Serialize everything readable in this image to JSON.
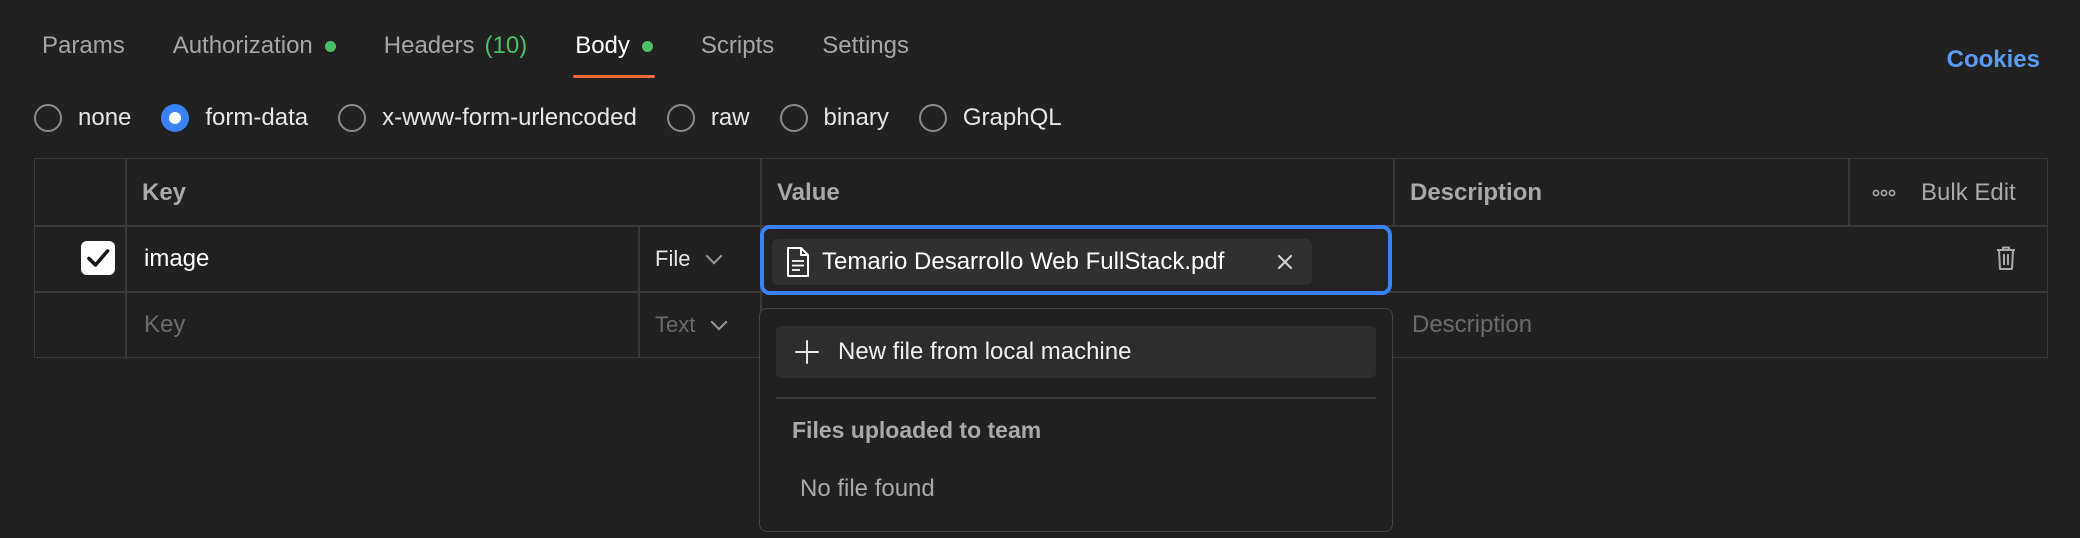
{
  "tabs": [
    {
      "label": "Params"
    },
    {
      "label": "Authorization",
      "indicator": true
    },
    {
      "label": "Headers",
      "count": "(10)"
    },
    {
      "label": "Body",
      "indicator": true,
      "active": true
    },
    {
      "label": "Scripts"
    },
    {
      "label": "Settings"
    }
  ],
  "cookies_label": "Cookies",
  "body_types": [
    {
      "label": "none",
      "checked": false
    },
    {
      "label": "form-data",
      "checked": true
    },
    {
      "label": "x-www-form-urlencoded",
      "checked": false
    },
    {
      "label": "raw",
      "checked": false
    },
    {
      "label": "binary",
      "checked": false
    },
    {
      "label": "GraphQL",
      "checked": false
    }
  ],
  "table": {
    "headers": {
      "key": "Key",
      "value": "Value",
      "description": "Description",
      "bulk_edit": "Bulk Edit"
    },
    "rows": [
      {
        "checked": true,
        "key": "image",
        "type": "File",
        "value_file": "Temario Desarrollo Web FullStack.pdf",
        "description": ""
      }
    ],
    "new_row": {
      "key_placeholder": "Key",
      "type": "Text",
      "description_placeholder": "Description"
    }
  },
  "file_dropdown": {
    "new_file_label": "New file from local machine",
    "section_heading": "Files uploaded to team",
    "empty_text": "No file found"
  },
  "colors": {
    "background": "#212121",
    "accent_tab": "#ef6a3a",
    "indicator": "#4fbf67",
    "focus_blue": "#3b82f6",
    "link_blue": "#5b9cf0"
  }
}
